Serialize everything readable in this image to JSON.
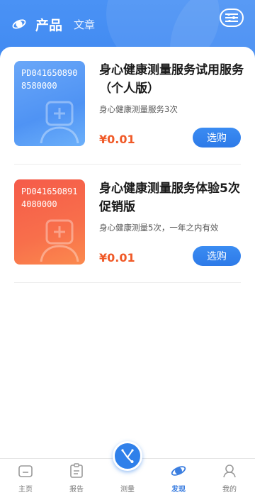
{
  "header": {
    "tab_products": "产品",
    "tab_articles": "文章"
  },
  "products": [
    {
      "code": "PD0416508908580000",
      "title": "身心健康测量服务试用服务（个人版）",
      "description": "身心健康测量服务3次",
      "price": "¥0.01",
      "button": "选购"
    },
    {
      "code": "PD0416508914080000",
      "title": "身心健康测量服务体验5次促销版",
      "description": "身心健康测量5次，一年之内有效",
      "price": "¥0.01",
      "button": "选购"
    }
  ],
  "tabbar": {
    "home": "主页",
    "report": "报告",
    "measure": "测量",
    "discover": "发现",
    "mine": "我的"
  },
  "colors": {
    "primary": "#3f88f0",
    "price": "#f05a28",
    "active_tab": "#3b7ee0"
  }
}
